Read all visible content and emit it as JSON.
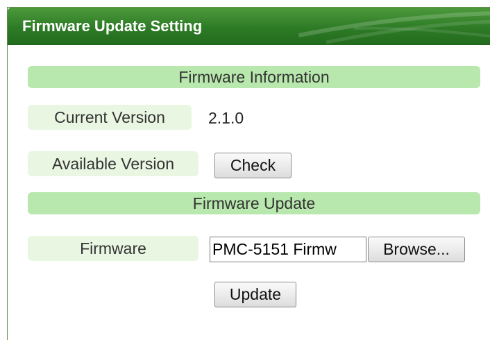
{
  "panel": {
    "title": "Firmware Update Setting"
  },
  "sections": {
    "info_header": "Firmware Information",
    "update_header": "Firmware Update"
  },
  "info": {
    "current_version_label": "Current Version",
    "current_version_value": "2.1.0",
    "available_version_label": "Available Version",
    "check_button": "Check"
  },
  "update": {
    "firmware_label": "Firmware",
    "file_name": "PMC-5151 Firmw",
    "browse_button": "Browse...",
    "update_button": "Update"
  },
  "colors": {
    "title_bar": "#2f7d27",
    "section_header": "#b8e8ad",
    "label_cell": "#e8f6e2"
  }
}
